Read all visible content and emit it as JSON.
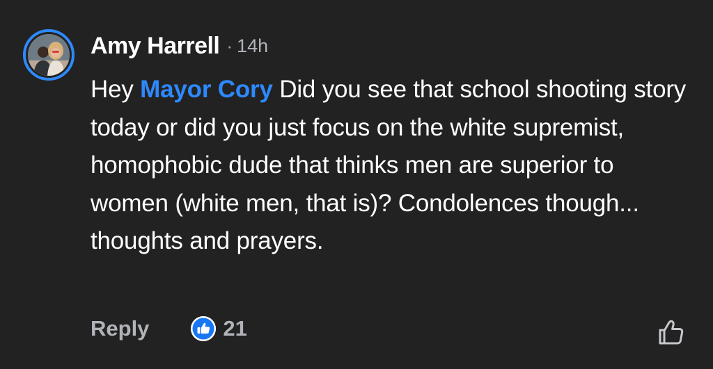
{
  "comment": {
    "author": "Amy Harrell",
    "separator": "·",
    "time": "14h",
    "text_before_mention": "Hey ",
    "mention": "Mayor Cory",
    "text_after_mention": " Did you see that school shooting story today or did you just focus on the white supremist, homophobic dude that thinks men are superior to women (white men, that is)? Condolences though... thoughts and prayers.",
    "avatar_icon": "profile-photo-avatar"
  },
  "actions": {
    "reply_label": "Reply",
    "reaction_icon": "like-reaction-icon",
    "reaction_count": "21",
    "like_button_icon": "thumbs-up-outline-icon"
  },
  "colors": {
    "background": "#222222",
    "text": "#ffffff",
    "secondary": "#b0b3b8",
    "accent": "#2e89ff"
  }
}
